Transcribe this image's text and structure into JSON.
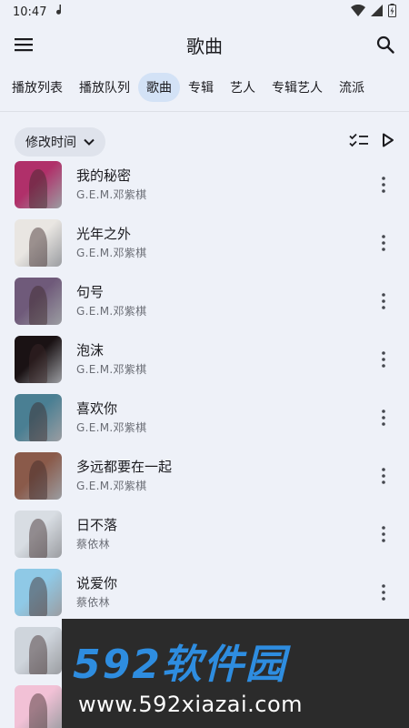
{
  "status": {
    "time": "10:47"
  },
  "header": {
    "title": "歌曲"
  },
  "tabs": [
    {
      "label": "播放列表"
    },
    {
      "label": "播放队列"
    },
    {
      "label": "歌曲",
      "active": true
    },
    {
      "label": "专辑"
    },
    {
      "label": "艺人"
    },
    {
      "label": "专辑艺人"
    },
    {
      "label": "流派"
    }
  ],
  "sort": {
    "label": "修改时间"
  },
  "songs": [
    {
      "title": "我的秘密",
      "artist": "G.E.M.邓紫棋",
      "cover_color": "#b0306a"
    },
    {
      "title": "光年之外",
      "artist": "G.E.M.邓紫棋",
      "cover_color": "#e9e6e2"
    },
    {
      "title": "句号",
      "artist": "G.E.M.邓紫棋",
      "cover_color": "#6f5a7a"
    },
    {
      "title": "泡沫",
      "artist": "G.E.M.邓紫棋",
      "cover_color": "#1a1214"
    },
    {
      "title": "喜欢你",
      "artist": "G.E.M.邓紫棋",
      "cover_color": "#4a7f93"
    },
    {
      "title": "多远都要在一起",
      "artist": "G.E.M.邓紫棋",
      "cover_color": "#8a5a4a"
    },
    {
      "title": "日不落",
      "artist": "蔡依林",
      "cover_color": "#d8dde3"
    },
    {
      "title": "说爱你",
      "artist": "蔡依林",
      "cover_color": "#8fc9e6"
    },
    {
      "title": "",
      "artist": "",
      "cover_color": "#cfd5dc"
    },
    {
      "title": "",
      "artist": "",
      "cover_color": "#f2c1d6"
    }
  ],
  "watermark": {
    "logo": "592软件园",
    "url": "www.592xiazai.com"
  },
  "colors": {
    "background": "#eef1f8",
    "active_tab": "#d3e2f6",
    "chip": "#dfe3ec",
    "watermark_blue": "#2e8de0"
  }
}
